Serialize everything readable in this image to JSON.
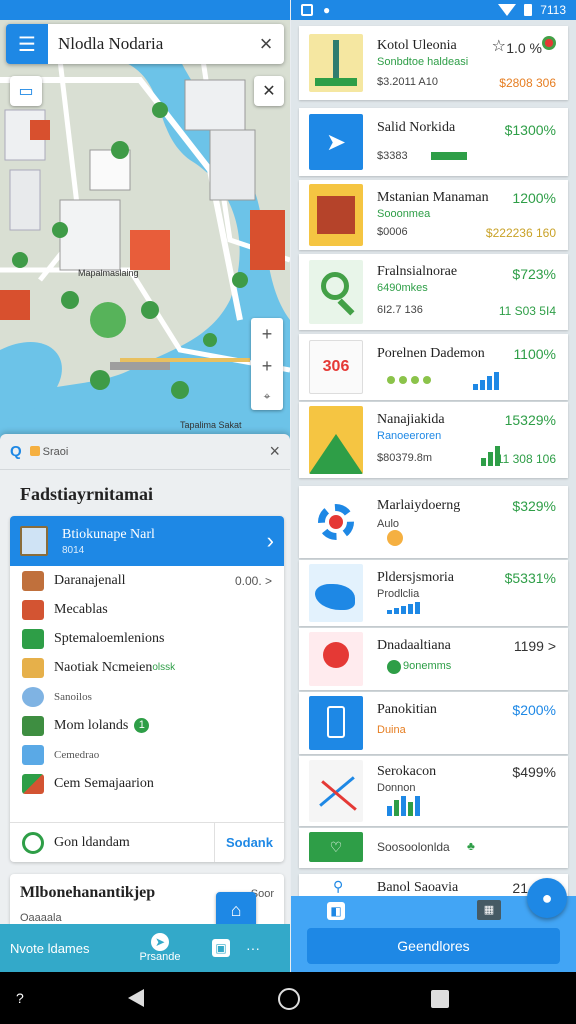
{
  "search": {
    "query": "Nlodla Nodaria"
  },
  "map": {
    "place_label": "Mapalmaslaing",
    "poi_label": "Tapalima Sakat"
  },
  "sheet": {
    "chip_label": "Sraoi",
    "title": "Fadstiayrnitamai",
    "selected": {
      "title": "Btiokunape Narl",
      "subtitle": "8014"
    },
    "items": [
      {
        "label": "Daranajenall",
        "value": "0.00. >"
      },
      {
        "label": "Mecablas"
      },
      {
        "label": "Sptemaloemlenions"
      },
      {
        "label": "Naotiak Ncmeien",
        "tag": "olssk"
      },
      {
        "label": "Sanoilos"
      },
      {
        "label": "Mom lolands",
        "badge": "1"
      },
      {
        "label": "Cemedrao"
      },
      {
        "label": "Cem Semajaarion"
      }
    ],
    "footer_label": "Gon ldandam",
    "footer_action": "Sodank",
    "second_title": "Mlbonehanantikjep",
    "second_sub": "Oaaaala",
    "second_meta": "Soor"
  },
  "left_bottom": {
    "label": "Nvote ldames",
    "center_label": "Prsande"
  },
  "right_cards": [
    {
      "title": "Kotol Uleonia",
      "subtitle": "Sonbdtoe haldeasi",
      "meta": "$3.2011 A10",
      "price": "1.0 %",
      "price2": "$2808 306"
    },
    {
      "title": "Salid Norkida",
      "meta": "$3383",
      "price": "$1300%"
    },
    {
      "title": "Mstanian Manaman",
      "subtitle": "Sooonmea",
      "meta": "$0006",
      "price": "1200%",
      "price3": "$222236 160"
    },
    {
      "title": "Fralnsialnorae",
      "subtitle": "6490mkes",
      "meta": "6I2.7 136",
      "price": "$723%",
      "price3": "11 S03 5I4"
    },
    {
      "title": "Porelnen Dademon",
      "price": "1100%"
    },
    {
      "title": "Nanajiakida",
      "subtitle": "Ranoeeroren",
      "meta": "$80379.8m",
      "price": "15329%",
      "price3": "11 308 106"
    },
    {
      "title": "Marlaiydoerng",
      "subtitle": "Aulo",
      "price": "$329%"
    },
    {
      "title": "Pldersjsmoria",
      "subtitle": "Prodlclia",
      "price": "$5331%"
    },
    {
      "title": "Dnadaaltiana",
      "subtitle": "9onemms",
      "price": "1199 >"
    },
    {
      "title": "Panokitian",
      "subtitle": "Duina",
      "price": "$200%"
    },
    {
      "title": "Serokacon",
      "subtitle": "Donnon",
      "price": "$499%"
    },
    {
      "title": "Soosoolonlda"
    },
    {
      "title": "Banol Saoavia",
      "price": "21"
    }
  ],
  "right_bottom": {
    "button_label": "Geendlores"
  },
  "status": {
    "time": "7113"
  },
  "colors": {
    "primary": "#1e88e5",
    "green": "#2e9e47",
    "orange": "#e67e22",
    "teal": "#33a9c9"
  }
}
